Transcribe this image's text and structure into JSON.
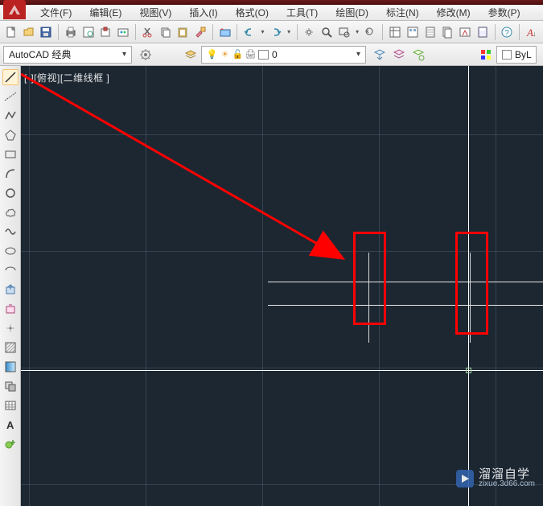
{
  "menus": [
    "文件(F)",
    "编辑(E)",
    "视图(V)",
    "插入(I)",
    "格式(O)",
    "工具(T)",
    "绘图(D)",
    "标注(N)",
    "修改(M)",
    "参数(P)"
  ],
  "workspace_selector": {
    "value": "AutoCAD 经典"
  },
  "layer_selector": {
    "value": "0"
  },
  "color_selector": {
    "value": "ByL"
  },
  "view_label": "[-][俯视][二维线框 ]",
  "watermark": {
    "brand": "溜溜自学",
    "sub": "zixue.3d66.com"
  }
}
